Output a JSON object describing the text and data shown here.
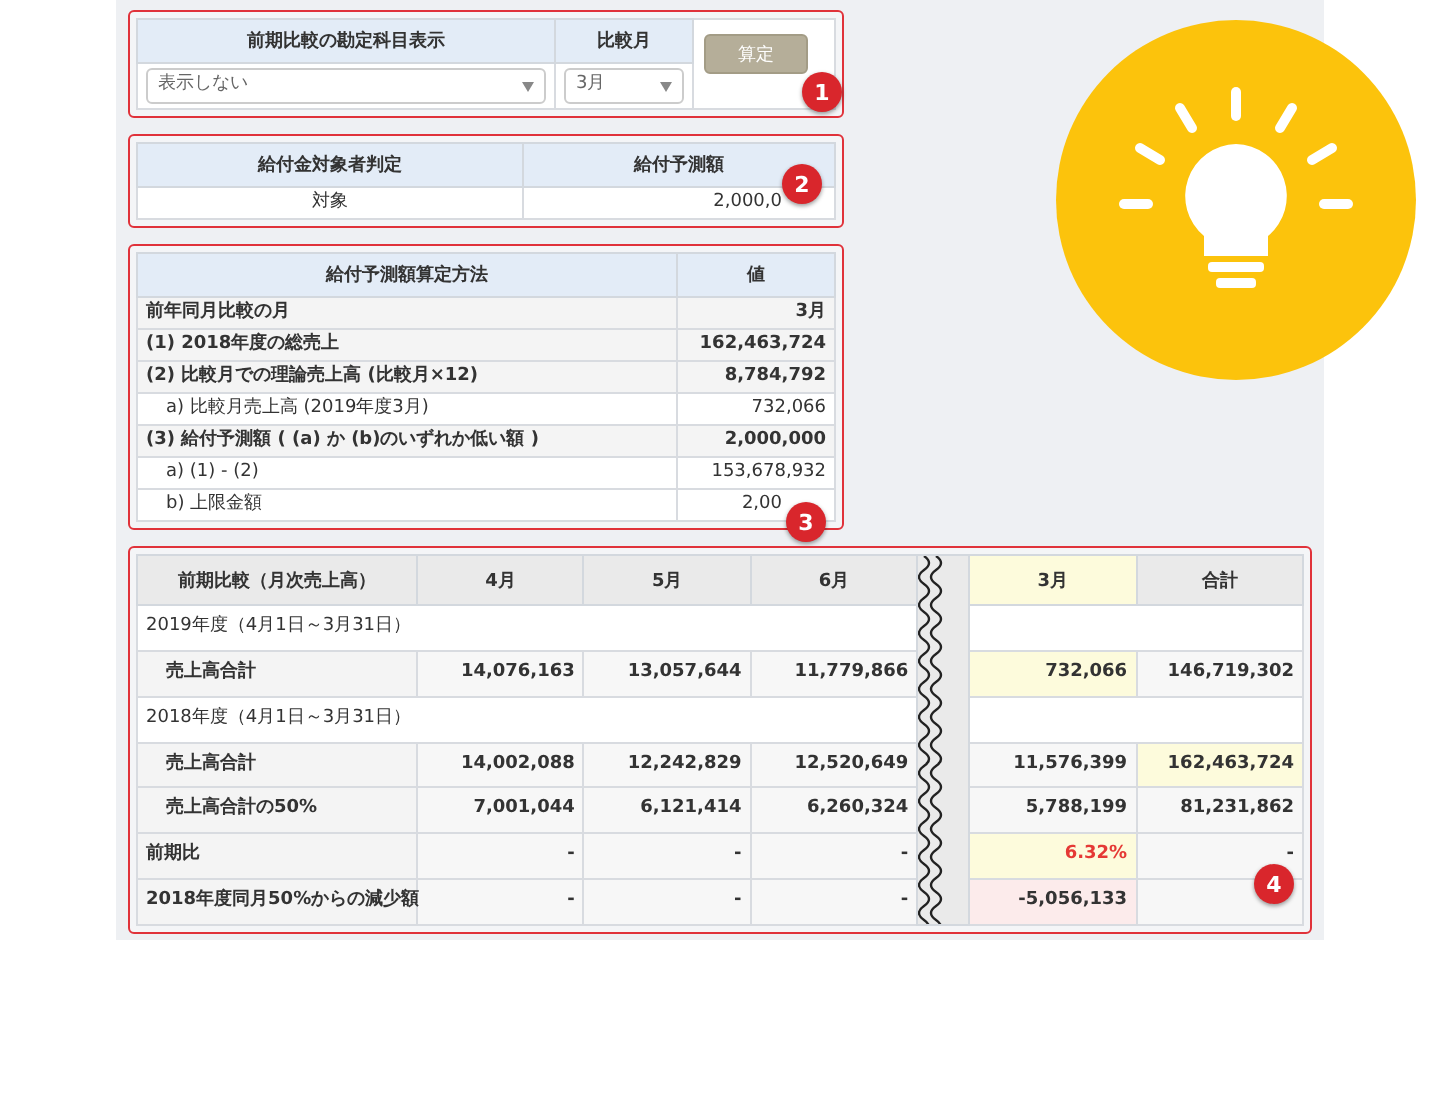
{
  "settings": {
    "columns": [
      "前期比較の勘定科目表示",
      "比較月"
    ],
    "account_select": {
      "value": "表示しない"
    },
    "month_select": {
      "value": "3月"
    },
    "button": "算定",
    "badge": "1"
  },
  "eligibility": {
    "columns": [
      "給付金対象者判定",
      "給付予測額"
    ],
    "values": [
      "対象",
      "2,000,0"
    ],
    "badge": "2"
  },
  "method": {
    "columns": [
      "給付予測額算定方法",
      "値"
    ],
    "badge": "3",
    "rows": [
      {
        "label": "前年同月比較の月",
        "value": "3月",
        "indent": false
      },
      {
        "label": "(1) 2018年度の総売上",
        "value": "162,463,724",
        "indent": false
      },
      {
        "label": "(2) 比較月での理論売上高 (比較月×12)",
        "value": "8,784,792",
        "indent": false
      },
      {
        "label": "a) 比較月売上高 (2019年度3月)",
        "value": "732,066",
        "indent": true
      },
      {
        "label": "(3) 給付予測額 ( (a) か (b)のいずれか低い額 )",
        "value": "2,000,000",
        "indent": false
      },
      {
        "label": "a) (1) - (2)",
        "value": "153,678,932",
        "indent": true
      },
      {
        "label": "b) 上限金額",
        "value": "2,00",
        "indent": true
      }
    ]
  },
  "comparison": {
    "badge": "4",
    "columns": [
      "前期比較（月次売上高）",
      "4月",
      "5月",
      "6月",
      "3月",
      "合計"
    ],
    "rows": [
      {
        "kind": "section",
        "label": "2019年度（4月1日～3月31日）"
      },
      {
        "kind": "data",
        "indent": true,
        "label": "売上高合計",
        "values": [
          "14,076,163",
          "13,057,644",
          "11,779,866"
        ],
        "march": {
          "text": "732,066",
          "highlighted": true,
          "flagged": false,
          "red": false
        },
        "total": {
          "text": "146,719,302",
          "highlighted": false,
          "flagged": false,
          "red": false
        }
      },
      {
        "kind": "section",
        "label": "2018年度（4月1日～3月31日）"
      },
      {
        "kind": "data",
        "indent": true,
        "label": "売上高合計",
        "values": [
          "14,002,088",
          "12,242,829",
          "12,520,649"
        ],
        "march": {
          "text": "11,576,399",
          "highlighted": false,
          "flagged": false,
          "red": false
        },
        "total": {
          "text": "162,463,724",
          "highlighted": true,
          "flagged": false,
          "red": false
        }
      },
      {
        "kind": "data",
        "indent": true,
        "label": "売上高合計の50%",
        "values": [
          "7,001,044",
          "6,121,414",
          "6,260,324"
        ],
        "march": {
          "text": "5,788,199",
          "highlighted": false,
          "flagged": false,
          "red": false
        },
        "total": {
          "text": "81,231,862",
          "highlighted": false,
          "flagged": false,
          "red": false
        }
      },
      {
        "kind": "data",
        "indent": false,
        "label": "前期比",
        "values": [
          "-",
          "-",
          "-"
        ],
        "march": {
          "text": "6.32%",
          "highlighted": true,
          "flagged": false,
          "red": true
        },
        "total": {
          "text": "-",
          "highlighted": false,
          "flagged": false,
          "red": false
        }
      },
      {
        "kind": "data",
        "indent": false,
        "label": "2018年度同月50%からの減少額",
        "values": [
          "-",
          "-",
          "-"
        ],
        "march": {
          "text": "-5,056,133",
          "highlighted": false,
          "flagged": true,
          "red": false
        }
      }
    ]
  }
}
